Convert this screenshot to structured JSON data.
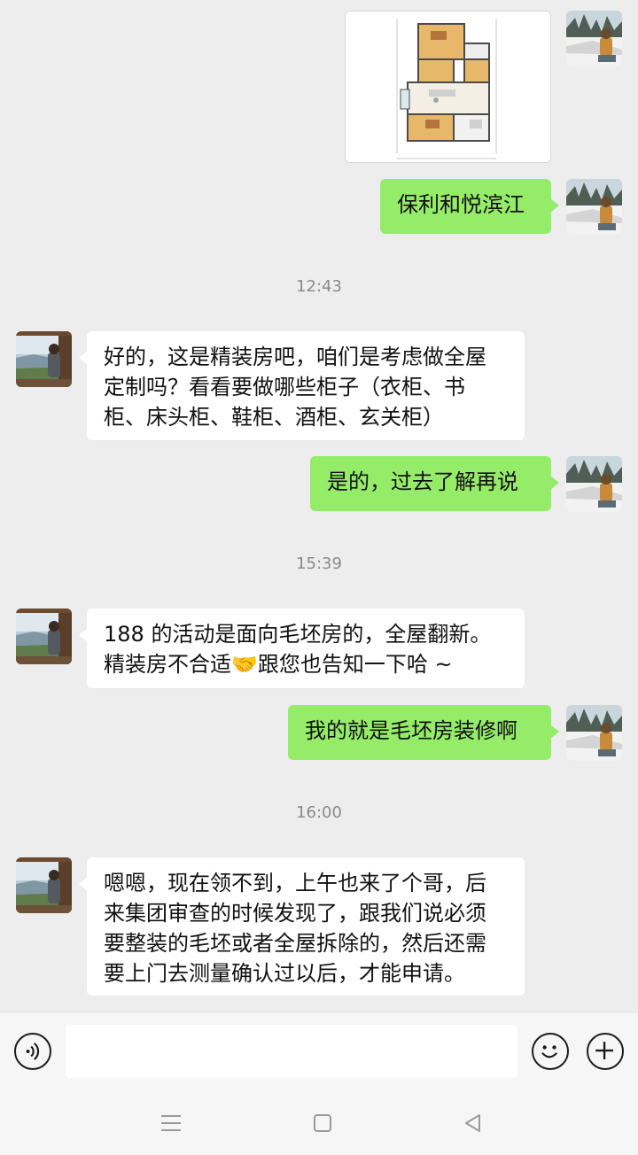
{
  "messages": [
    {
      "side": "right",
      "type": "image",
      "image": "floor-plan"
    },
    {
      "side": "right",
      "type": "text",
      "text": "保利和悦滨江"
    },
    {
      "type": "time",
      "text": "12:43"
    },
    {
      "side": "left",
      "type": "text",
      "text": "好的，这是精装房吧，咱们是考虑做全屋定制吗？看看要做哪些柜子（衣柜、书柜、床头柜、鞋柜、酒柜、玄关柜）"
    },
    {
      "side": "right",
      "type": "text",
      "text": "是的，过去了解再说"
    },
    {
      "type": "time",
      "text": "15:39"
    },
    {
      "side": "left",
      "type": "text",
      "text": "188 的活动是面向毛坯房的，全屋翻新。精装房不合适🤝跟您也告知一下哈 ~"
    },
    {
      "side": "right",
      "type": "text",
      "text": "我的就是毛坯房装修啊"
    },
    {
      "type": "time",
      "text": "16:00"
    },
    {
      "side": "left",
      "type": "text",
      "text": "嗯嗯，现在领不到，上午也来了个哥，后来集团审查的时候发现了，跟我们说必须要整装的毛坯或者全屋拆除的，然后还需要上门去测量确认过以后，才能申请。"
    }
  ],
  "display": {
    "m1": "保利和悦滨江",
    "t1": "12:43",
    "m2": "好的，这是精装房吧，咱们是考虑做全屋\n定制吗？看看要做哪些柜子（衣柜、书\n柜、床头柜、鞋柜、酒柜、玄关柜）",
    "m3": "是的，过去了解再说",
    "t2": "15:39",
    "m4": "188 的活动是面向毛坯房的，全屋翻新。\n精装房不合适🤝跟您也告知一下哈 ~",
    "m5": "我的就是毛坯房装修啊",
    "t3": "16:00",
    "m6": "嗯嗯，现在领不到，上午也来了个哥，后\n来集团审查的时候发现了，跟我们说必须\n要整装的毛坯或者全屋拆除的，然后还需\n要上门去测量确认过以后，才能申请。"
  },
  "input_bar": {
    "voice_icon": "voice-icon",
    "emoji_icon": "emoji-icon",
    "plus_icon": "plus-icon",
    "input_value": ""
  },
  "nav_bar": {
    "icons": [
      "menu-icon",
      "home-square-icon",
      "back-triangle-icon"
    ]
  },
  "colors": {
    "background": "#ededed",
    "sent_bubble": "#95ec69",
    "received_bubble": "#ffffff",
    "timestamp": "#8a8a8a"
  }
}
